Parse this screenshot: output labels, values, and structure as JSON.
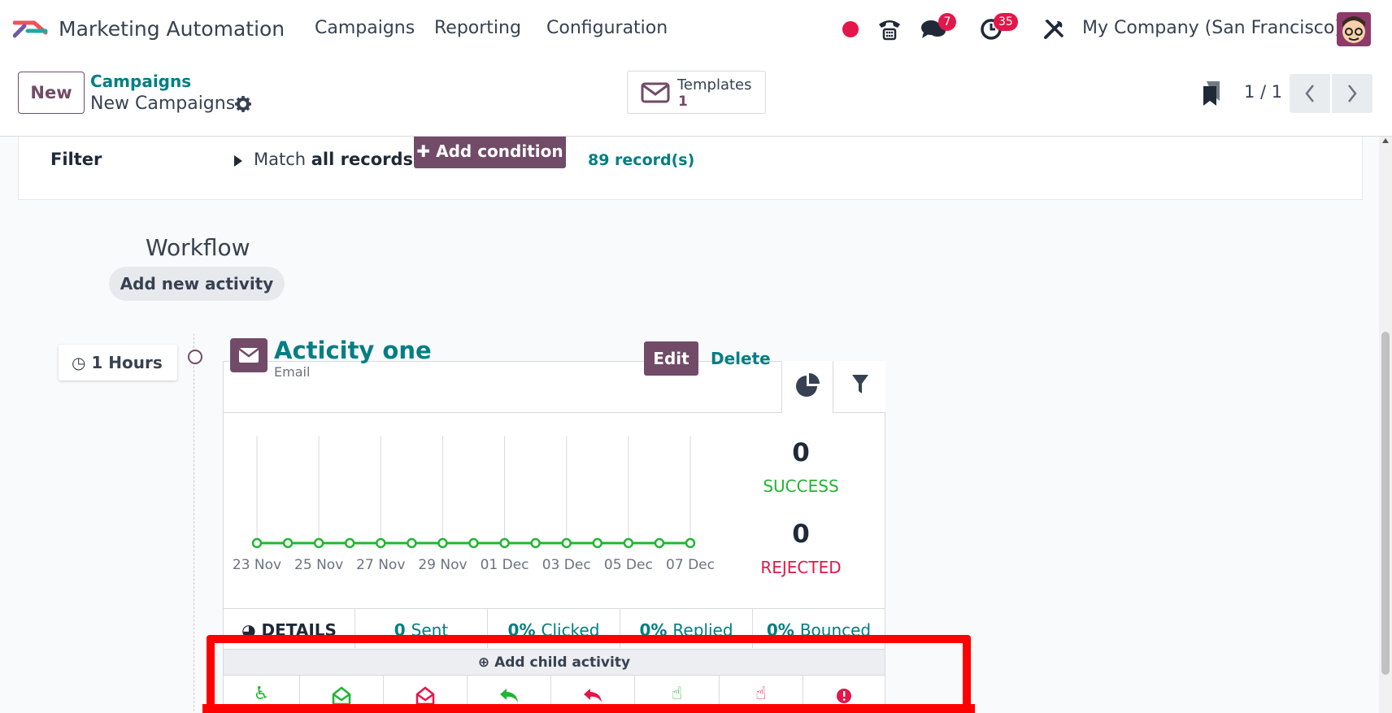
{
  "nav": {
    "app_title": "Marketing Automation",
    "menu": [
      "Campaigns",
      "Reporting",
      "Configuration"
    ],
    "messages_badge": "7",
    "activities_badge": "35",
    "company": "My Company (San Francisco)"
  },
  "control": {
    "new_label": "New",
    "breadcrumb_parent": "Campaigns",
    "breadcrumb_current": "New Campaigns",
    "templates_label": "Templates",
    "templates_count": "1",
    "pager": "1 / 1"
  },
  "filter": {
    "label": "Filter",
    "match_prefix": "Match",
    "match_bold": "all records",
    "add_condition": "Add condition",
    "records": "89 record(s)"
  },
  "workflow": {
    "title": "Workflow",
    "add_activity": "Add new activity"
  },
  "activity": {
    "interval": "1 Hours",
    "name": "Acticity one",
    "type": "Email",
    "edit": "Edit",
    "delete": "Delete",
    "success_value": "0",
    "success_label": "SUCCESS",
    "rejected_value": "0",
    "rejected_label": "REJECTED",
    "stats": [
      {
        "value": "",
        "label": "DETAILS"
      },
      {
        "value": "0",
        "label": "Sent"
      },
      {
        "value": "0%",
        "label": "Clicked"
      },
      {
        "value": "0%",
        "label": "Replied"
      },
      {
        "value": "0%",
        "label": "Bounced"
      }
    ],
    "add_child": "Add child activity",
    "child_icons": [
      "walk-icon",
      "mail-open-icon",
      "mail-not-open-icon",
      "reply-icon",
      "not-reply-icon",
      "click-icon",
      "not-click-icon",
      "bounce-icon"
    ]
  },
  "chart_data": {
    "type": "line",
    "x": [
      "23 Nov",
      "24 Nov",
      "25 Nov",
      "26 Nov",
      "27 Nov",
      "28 Nov",
      "29 Nov",
      "30 Nov",
      "01 Dec",
      "02 Dec",
      "03 Dec",
      "04 Dec",
      "05 Dec",
      "06 Dec",
      "07 Dec"
    ],
    "tick_labels": [
      "23 Nov",
      "25 Nov",
      "27 Nov",
      "29 Nov",
      "01 Dec",
      "03 Dec",
      "05 Dec",
      "07 Dec"
    ],
    "series": [
      {
        "values": [
          0,
          0,
          0,
          0,
          0,
          0,
          0,
          0,
          0,
          0,
          0,
          0,
          0,
          0,
          0
        ],
        "color": "#21b532"
      }
    ],
    "grid": "vertical",
    "legend": "none"
  },
  "colors": {
    "brand": "#714b67",
    "teal": "#017e84",
    "success": "#21b532",
    "danger": "#e3174a",
    "highlight": "#ff0000"
  }
}
